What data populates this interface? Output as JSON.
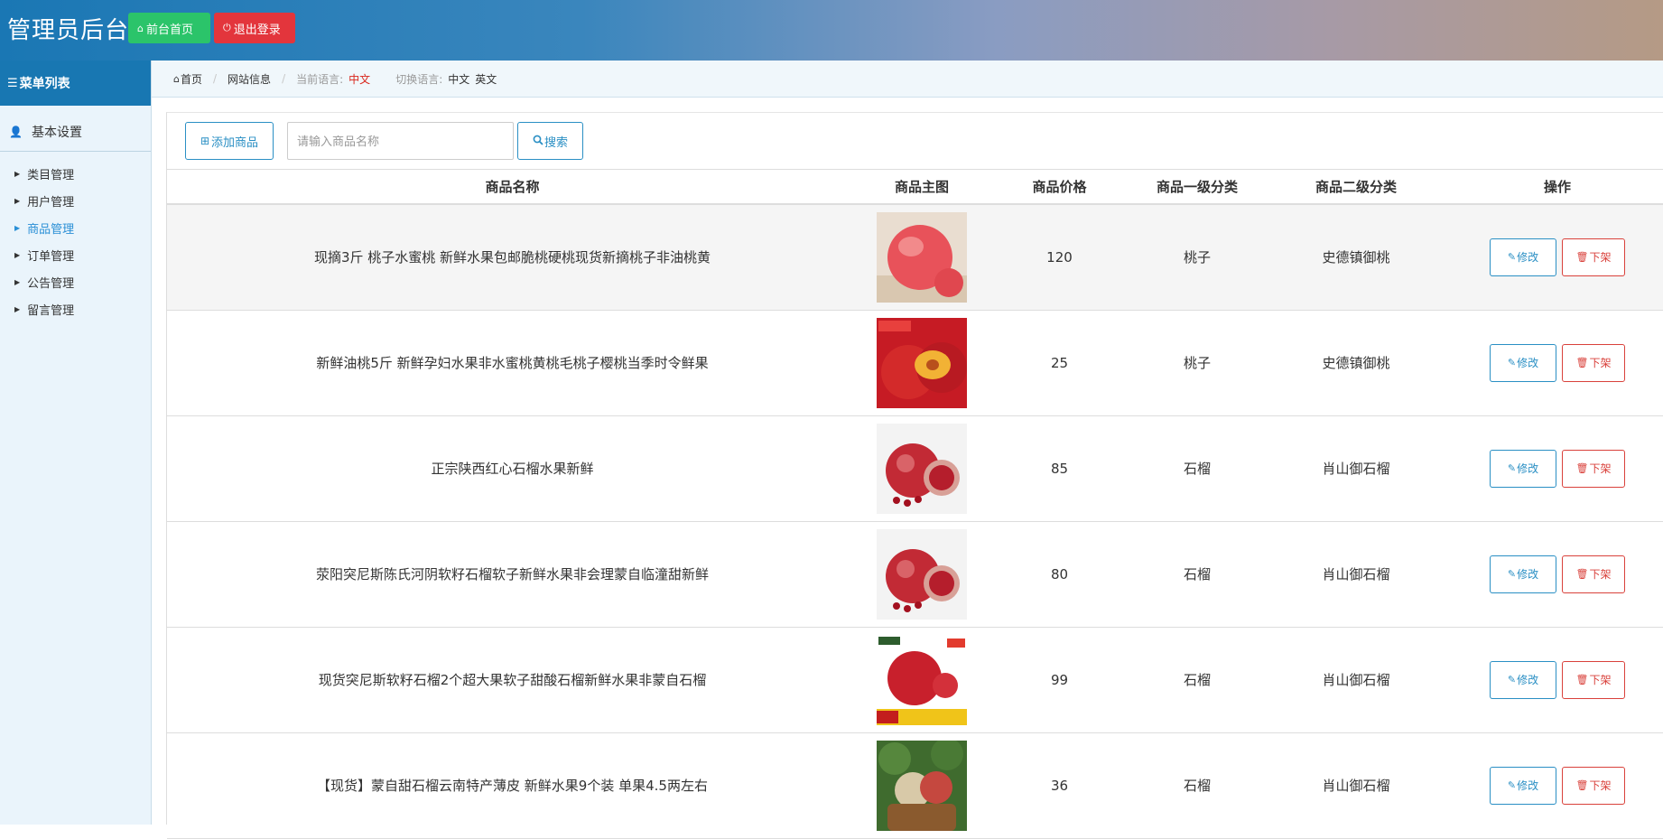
{
  "header": {
    "title": "管理员后台",
    "home_label": "前台首页",
    "logout_label": "退出登录",
    "home_color": "#2bc46a",
    "logout_color": "#e3353c"
  },
  "sidebar": {
    "menu_title": "菜单列表",
    "group_label": "基本设置",
    "items": [
      {
        "label": "类目管理",
        "active": false
      },
      {
        "label": "用户管理",
        "active": false
      },
      {
        "label": "商品管理",
        "active": true
      },
      {
        "label": "订单管理",
        "active": false
      },
      {
        "label": "公告管理",
        "active": false
      },
      {
        "label": "留言管理",
        "active": false
      }
    ]
  },
  "breadcrumb": {
    "home": "首页",
    "site_info": "网站信息",
    "current_lang_label": "当前语言:",
    "current_lang": "中文",
    "switch_label": "切换语言:",
    "lang_zh": "中文",
    "lang_en": "英文"
  },
  "toolbar": {
    "add_label": "添加商品",
    "search_placeholder": "请输入商品名称",
    "search_label": "搜索"
  },
  "table": {
    "headers": [
      "商品名称",
      "商品主图",
      "商品价格",
      "商品一级分类",
      "商品二级分类",
      "操作"
    ],
    "edit_label": "修改",
    "off_label": "下架",
    "rows": [
      {
        "name": "现摘3斤 桃子水蜜桃 新鲜水果包邮脆桃硬桃现货新摘桃子非油桃黄",
        "price": "120",
        "cat1": "桃子",
        "cat2": "史德镇御桃",
        "image": "peach-image"
      },
      {
        "name": "新鲜油桃5斤 新鲜孕妇水果非水蜜桃黄桃毛桃子樱桃当季时令鲜果",
        "price": "25",
        "cat1": "桃子",
        "cat2": "史德镇御桃",
        "image": "nectarine-image"
      },
      {
        "name": "正宗陕西红心石榴水果新鲜",
        "price": "85",
        "cat1": "石榴",
        "cat2": "肖山御石榴",
        "image": "pomegranate-image"
      },
      {
        "name": "荥阳突尼斯陈氏河阴软籽石榴软子新鲜水果非会理蒙自临潼甜新鲜",
        "price": "80",
        "cat1": "石榴",
        "cat2": "肖山御石榴",
        "image": "pomegranate-image"
      },
      {
        "name": "现货突尼斯软籽石榴2个超大果软子甜酸石榴新鲜水果非蒙自石榴",
        "price": "99",
        "cat1": "石榴",
        "cat2": "肖山御石榴",
        "image": "pomegranate-ad-image"
      },
      {
        "name": "【现货】蒙自甜石榴云南特产薄皮 新鲜水果9个装 单果4.5两左右",
        "price": "36",
        "cat1": "石榴",
        "cat2": "肖山御石榴",
        "image": "pomegranate-basket-image"
      }
    ]
  }
}
